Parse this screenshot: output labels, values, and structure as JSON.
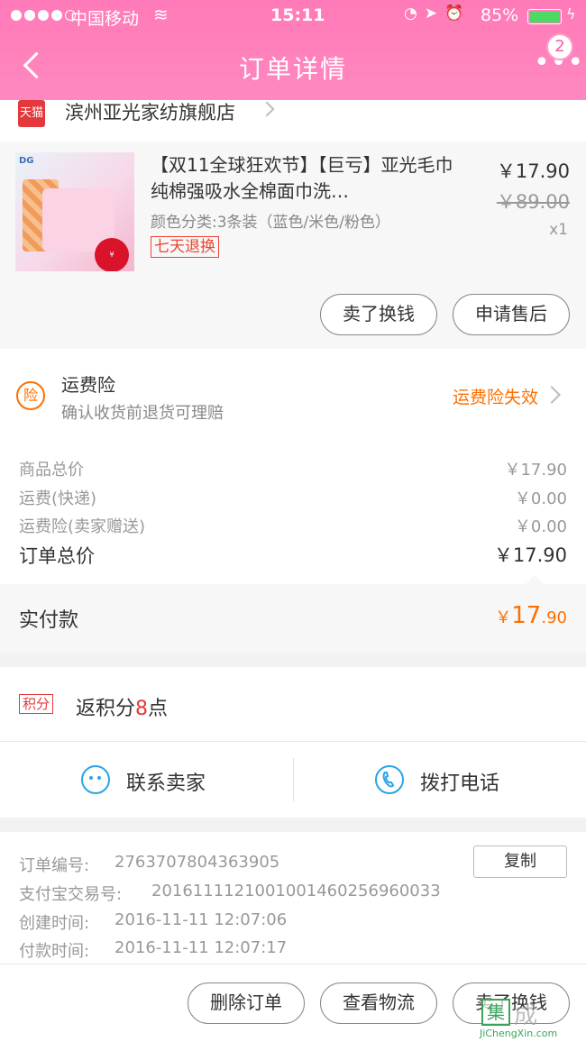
{
  "status_bar": {
    "carrier": "中国移动",
    "time": "15:11",
    "battery": "85%"
  },
  "nav": {
    "title": "订单详情",
    "badge_count": "2"
  },
  "shop": {
    "logo_text": "天猫",
    "name": "滨州亚光家纺旗舰店"
  },
  "product": {
    "title": "【双11全球狂欢节】【巨亏】亚光毛巾 纯棉强吸水全棉面巾洗…",
    "attribute": "颜色分类:3条装（蓝色/米色/粉色）",
    "return_badge": "七天退换",
    "price": "￥17.90",
    "original_price": "￥89.00",
    "quantity": "x1",
    "sell_button": "卖了换钱",
    "aftersale_button": "申请售后"
  },
  "shipping_insurance": {
    "icon_char": "险",
    "title": "运费险",
    "subtitle": "确认收货前退货可理赔",
    "status": "运费险失效"
  },
  "fees": {
    "goods_label": "商品总价",
    "goods_value": "￥17.90",
    "shipping_label": "运费(快递)",
    "shipping_value": "￥0.00",
    "insurance_label": "运费险(卖家赠送)",
    "insurance_value": "￥0.00",
    "total_label": "订单总价",
    "total_value": "￥17.90"
  },
  "payment": {
    "label": "实付款",
    "currency": "￥",
    "integer": "17",
    "decimal": ".90"
  },
  "points": {
    "badge": "积分",
    "prefix": "返积分",
    "number": "8",
    "suffix": "点"
  },
  "contact": {
    "seller_label": "联系卖家",
    "phone_label": "拨打电话"
  },
  "order_info": {
    "order_no_label": "订单编号:",
    "order_no": "2763707804363905",
    "copy_button": "复制",
    "alipay_label": "支付宝交易号:",
    "alipay_no": "2016111121001001460256960033",
    "created_label": "创建时间:",
    "created_time": "2016-11-11 12:07:06",
    "paid_label": "付款时间:",
    "paid_time": "2016-11-11 12:07:17"
  },
  "actions": {
    "delete": "删除订单",
    "logistics": "查看物流",
    "sell": "卖了换钱"
  },
  "watermark": {
    "char": "集",
    "cn": "成",
    "en": "JiChengXin.com"
  },
  "colors": {
    "header_pink": "#ff7ab8",
    "accent_orange": "#ff6f00",
    "tmall_red": "#e4393c",
    "contact_blue": "#2aa4e6"
  }
}
